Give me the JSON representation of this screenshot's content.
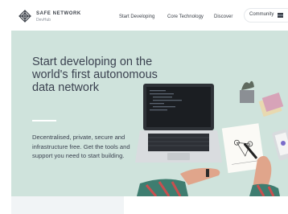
{
  "brand": {
    "name": "SAFE NETWORK",
    "sub": "DevHub"
  },
  "nav": [
    {
      "label": "Start Developing"
    },
    {
      "label": "Core Technology"
    },
    {
      "label": "Discover"
    }
  ],
  "community": {
    "label": "Community"
  },
  "hero": {
    "title": "Start developing on the world's first autonomous data network",
    "body": "Decentralised, private, secure and infrastructure free. Get the tools and support you need to start building."
  },
  "colors": {
    "hero_bg": "#cfe3dc",
    "text_dark": "#3b4250",
    "accent_green": "#2f7d5f"
  },
  "icons": [
    "safe-network-logo-icon",
    "community-flag-icon"
  ]
}
